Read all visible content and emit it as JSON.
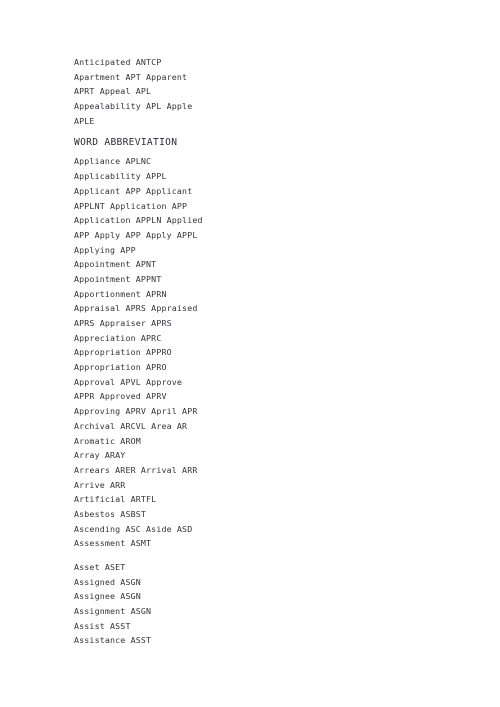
{
  "document": {
    "type": "abbreviation-list",
    "text_color": "#33333a",
    "background_color": "#ffffff",
    "heading": "WORD ABBREVIATION",
    "sections": [
      {
        "id": "section-top",
        "lines": [
          "Anticipated ANTCP",
          "Apartment APT Apparent",
          "APRT Appeal APL",
          "Appealability APL Apple",
          "APLE"
        ]
      },
      {
        "id": "section-main",
        "lines": [
          "Appliance APLNC",
          "Applicability APPL",
          "Applicant APP Applicant",
          "APPLNT Application APP",
          "Application APPLN Applied",
          "APP Apply APP Apply APPL",
          "Applying APP",
          "Appointment APNT",
          "Appointment APPNT",
          "Apportionment APRN",
          "Appraisal APRS Appraised",
          "APRS Appraiser APRS",
          "Appreciation APRC",
          "Appropriation APPRO",
          "Appropriation APRO",
          "Approval APVL Approve",
          "APPR Approved APRV",
          "Approving APRV April APR",
          "Archival ARCVL Area AR",
          "Aromatic AROM",
          "Array ARAY",
          "Arrears ARER Arrival ARR",
          "Arrive ARR",
          "Artificial ARTFL",
          "Asbestos ASBST",
          "Ascending ASC Aside ASD",
          "Assessment ASMT"
        ]
      },
      {
        "id": "section-assets",
        "lines": [
          "Asset ASET",
          "Assigned ASGN",
          "Assignee ASGN",
          "Assignment ASGN",
          "Assist ASST",
          "Assistance ASST"
        ]
      }
    ]
  }
}
